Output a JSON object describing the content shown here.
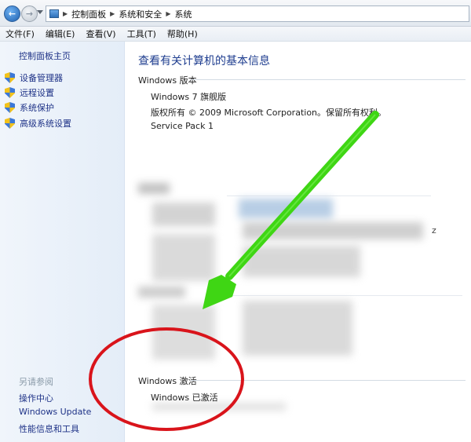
{
  "breadcrumb": [
    "控制面板",
    "系统和安全",
    "系统"
  ],
  "menu": [
    "文件(F)",
    "编辑(E)",
    "查看(V)",
    "工具(T)",
    "帮助(H)"
  ],
  "sidebar": {
    "home": "控制面板主页",
    "items": [
      "设备管理器",
      "远程设置",
      "系统保护",
      "高级系统设置"
    ],
    "see_also_title": "另请参阅",
    "see_also": [
      "操作中心",
      "Windows Update",
      "性能信息和工具"
    ]
  },
  "main": {
    "title": "查看有关计算机的基本信息",
    "edition": {
      "header": "Windows 版本",
      "name": "Windows 7 旗舰版",
      "copyright": "版权所有 © 2009 Microsoft Corporation。保留所有权利。",
      "sp": "Service Pack 1"
    },
    "activation": {
      "header": "Windows 激活",
      "status": "Windows 已激活"
    },
    "blurred_fragment": "z"
  },
  "annotation_colors": {
    "arrow": "#3fd614",
    "circle": "#d9141b"
  },
  "icons": [
    "back-arrow-icon",
    "forward-arrow-icon",
    "control-panel-icon",
    "uac-shield-icon"
  ]
}
